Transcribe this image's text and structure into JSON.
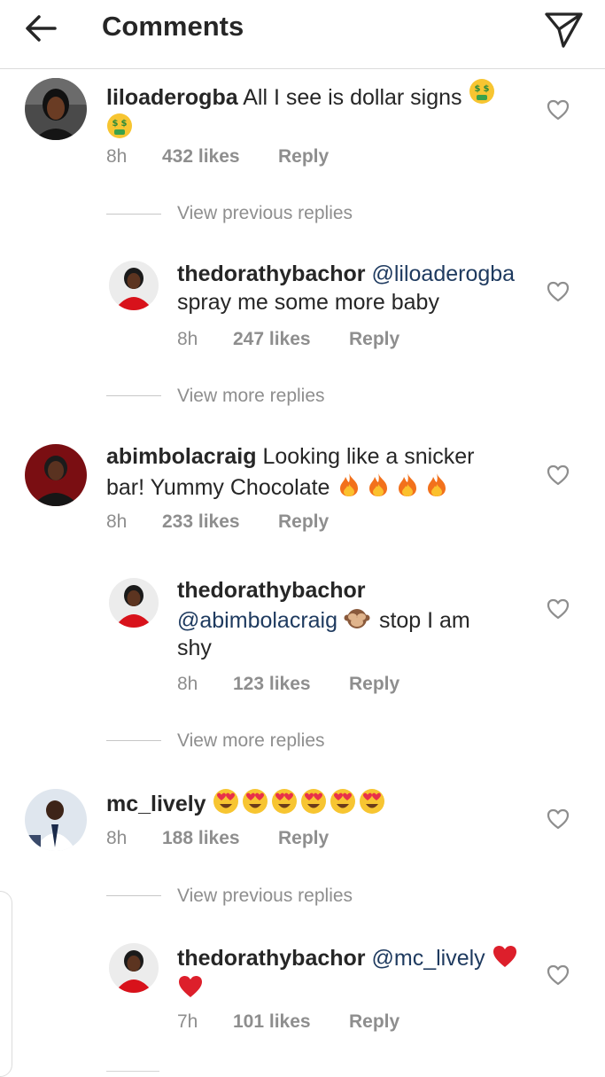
{
  "header": {
    "title": "Comments",
    "back_icon": "arrow-left-icon",
    "share_icon": "paper-plane-icon"
  },
  "comments": [
    {
      "username": "liloaderogba",
      "text": "All I see is dollar signs",
      "emojis": [
        "money-mouth-face",
        "money-mouth-face"
      ],
      "time": "8h",
      "likes": "432 likes",
      "reply_label": "Reply",
      "thread_link": "View previous replies"
    },
    {
      "username": "thedorathybachor",
      "mention": "@liloaderogba",
      "text": "spray me some more baby",
      "time": "8h",
      "likes": "247 likes",
      "reply_label": "Reply",
      "thread_link": "View more replies"
    },
    {
      "username": "abimbolacraig",
      "text_line1": "Looking like a snicker",
      "text_line2": "bar! Yummy Chocolate",
      "emojis": [
        "fire",
        "fire",
        "fire",
        "fire"
      ],
      "time": "8h",
      "likes": "233 likes",
      "reply_label": "Reply"
    },
    {
      "username": "thedorathybachor",
      "mention": "@abimbolacraig",
      "emojis": [
        "see-no-evil-monkey"
      ],
      "text_line1": "stop I am",
      "text_line2": "shy",
      "time": "8h",
      "likes": "123 likes",
      "reply_label": "Reply",
      "thread_link": "View more replies"
    },
    {
      "username": "mc_lively",
      "emojis": [
        "heart-eyes",
        "heart-eyes",
        "heart-eyes",
        "heart-eyes",
        "heart-eyes",
        "heart-eyes"
      ],
      "time": "8h",
      "likes": "188 likes",
      "reply_label": "Reply",
      "thread_link": "View previous replies"
    },
    {
      "username": "thedorathybachor",
      "mention": "@mc_lively",
      "emojis": [
        "red-heart",
        "red-heart"
      ],
      "time": "7h",
      "likes": "101 likes",
      "reply_label": "Reply"
    }
  ],
  "colors": {
    "text": "#262626",
    "muted": "#8e8e8e",
    "mention": "#1e3a5f",
    "divider": "#dbdbdb"
  }
}
